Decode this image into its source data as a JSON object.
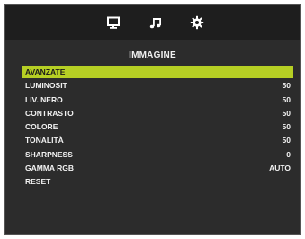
{
  "tabs": [
    {
      "name": "picture",
      "icon": "monitor-icon",
      "active": true
    },
    {
      "name": "audio",
      "icon": "music-note-icon",
      "active": false
    },
    {
      "name": "settings",
      "icon": "gear-icon",
      "active": false
    }
  ],
  "menu": {
    "title": "IMMAGINE",
    "accent_color": "#b6cf24",
    "items": [
      {
        "label": "AVANZATE",
        "value": "",
        "selected": true
      },
      {
        "label": "LUMINOSIT",
        "value": "50"
      },
      {
        "label": "LIV. NERO",
        "value": "50"
      },
      {
        "label": "CONTRASTO",
        "value": "50"
      },
      {
        "label": "COLORE",
        "value": "50"
      },
      {
        "label": "TONALITÀ",
        "value": "50"
      },
      {
        "label": "SHARPNESS",
        "value": "0"
      },
      {
        "label": "GAMMA RGB",
        "value": "AUTO"
      },
      {
        "label": "RESET",
        "value": ""
      }
    ]
  }
}
